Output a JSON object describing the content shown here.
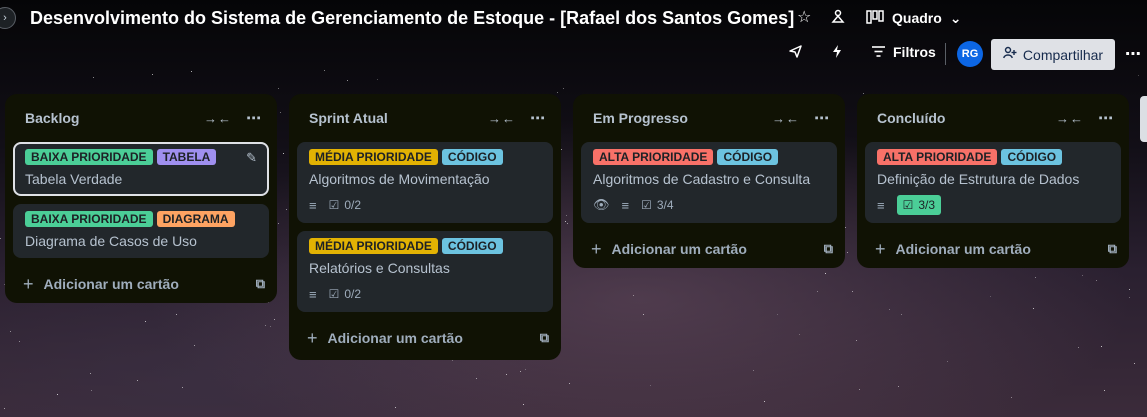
{
  "board": {
    "title": "Desenvolvimento do Sistema de Gerenciamento de Estoque - [Rafael dos Santos Gomes]",
    "view_label": "Quadro",
    "star_icon": "star-icon",
    "visibility_icon": "workspace-visibility-icon"
  },
  "toolbar": {
    "filters_label": "Filtros",
    "avatar_initials": "RG",
    "share_label": "Compartilhar"
  },
  "colors": {
    "baixa": "#4bce97",
    "media": "#e2b203",
    "alta": "#f87168",
    "tabela": "#9f8fef",
    "diagrama": "#fea362",
    "codigo": "#6cc3e0",
    "done_badge": "#4bce97",
    "share_button": "#dfe1e6",
    "avatar": "#0c66e4"
  },
  "add_card_label": "Adicionar um cartão",
  "lists": [
    {
      "title": "Backlog",
      "cards": [
        {
          "labels": [
            {
              "text": "BAIXA PRIORIDADE",
              "color": "baixa"
            },
            {
              "text": "TABELA",
              "color": "tabela"
            }
          ],
          "title": "Tabela Verdade"
        },
        {
          "labels": [
            {
              "text": "BAIXA PRIORIDADE",
              "color": "baixa"
            },
            {
              "text": "DIAGRAMA",
              "color": "diagrama"
            }
          ],
          "title": "Diagrama de Casos de Uso"
        }
      ]
    },
    {
      "title": "Sprint Atual",
      "cards": [
        {
          "labels": [
            {
              "text": "MÉDIA PRIORIDADE",
              "color": "media"
            },
            {
              "text": "CÓDIGO",
              "color": "codigo"
            }
          ],
          "title": "Algoritmos de Movimentação",
          "checklist": "0/2"
        },
        {
          "labels": [
            {
              "text": "MÉDIA PRIORIDADE",
              "color": "media"
            },
            {
              "text": "CÓDIGO",
              "color": "codigo"
            }
          ],
          "title": "Relatórios e Consultas",
          "checklist": "0/2"
        }
      ]
    },
    {
      "title": "Em Progresso",
      "cards": [
        {
          "labels": [
            {
              "text": "ALTA PRIORIDADE",
              "color": "alta"
            },
            {
              "text": "CÓDIGO",
              "color": "codigo"
            }
          ],
          "title": "Algoritmos de Cadastro e Consulta",
          "checklist": "3/4"
        }
      ]
    },
    {
      "title": "Concluído",
      "cards": [
        {
          "labels": [
            {
              "text": "ALTA PRIORIDADE",
              "color": "alta"
            },
            {
              "text": "CÓDIGO",
              "color": "codigo"
            }
          ],
          "title": "Definição de Estrutura de Dados",
          "checklist": "3/3"
        }
      ]
    }
  ]
}
